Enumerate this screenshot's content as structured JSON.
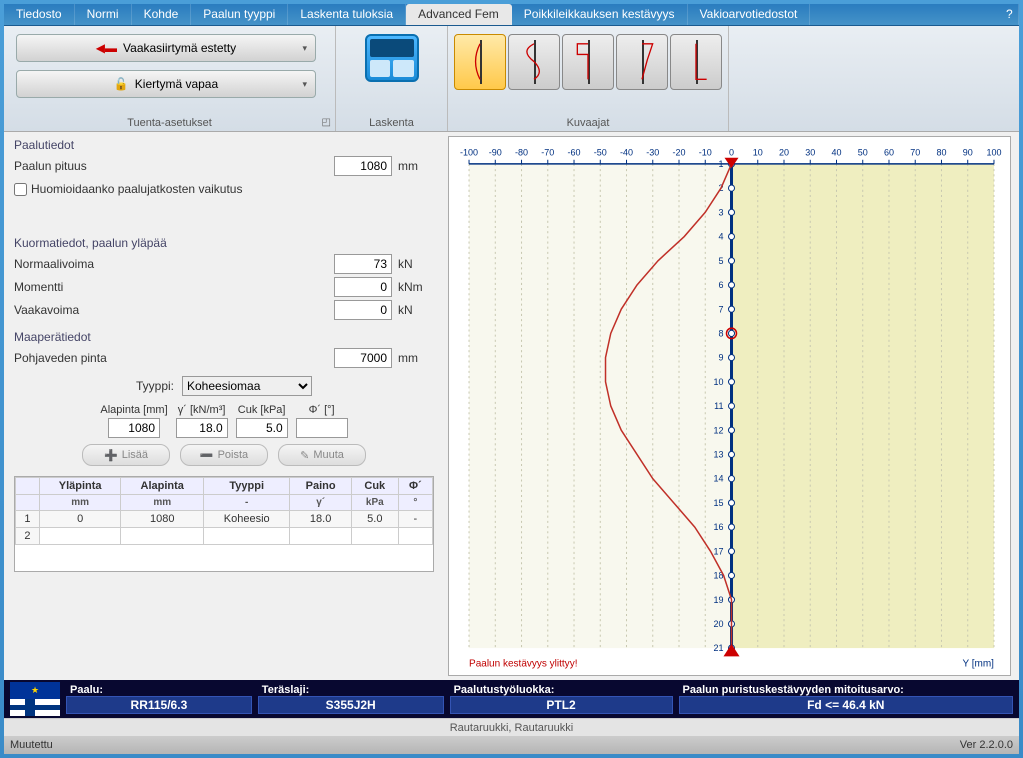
{
  "menu": {
    "items": [
      "Tiedosto",
      "Normi",
      "Kohde",
      "Paalun tyyppi",
      "Laskenta tuloksia",
      "Advanced Fem",
      "Poikkileikkauksen kestävyys",
      "Vakioarvotiedostot"
    ],
    "active_index": 5,
    "help": "?"
  },
  "ribbon": {
    "support": {
      "btn1": "Vaakasiirtymä estetty",
      "btn2": "Kiertymä vapaa",
      "label": "Tuenta-asetukset"
    },
    "calc": {
      "label": "Laskenta"
    },
    "charts": {
      "label": "Kuvaajat"
    }
  },
  "left": {
    "pile": {
      "title": "Paalutiedot",
      "length_label": "Paalun pituus",
      "length_value": "1080",
      "length_unit": "mm",
      "cb_label": "Huomioidaanko paalujatkosten vaikutus"
    },
    "loads": {
      "title": "Kuormatiedot, paalun yläpää",
      "n_label": "Normaalivoima",
      "n_value": "73",
      "n_unit": "kN",
      "m_label": "Momentti",
      "m_value": "0",
      "m_unit": "kNm",
      "v_label": "Vaakavoima",
      "v_value": "0",
      "v_unit": "kN"
    },
    "soil": {
      "title": "Maaperätiedot",
      "gw_label": "Pohjaveden pinta",
      "gw_value": "7000",
      "gw_unit": "mm",
      "type_label": "Tyyppi:",
      "type_value": "Koheesiomaa",
      "cols": {
        "alapinta": "Alapinta [mm]",
        "gamma": "γ´ [kN/m³]",
        "cuk": "Cuk [kPa]",
        "phi": "Φ´ [°]"
      },
      "vals": {
        "alapinta": "1080",
        "gamma": "18.0",
        "cuk": "5.0",
        "phi": ""
      },
      "btns": {
        "add": "Lisää",
        "del": "Poista",
        "edit": "Muuta"
      }
    },
    "grid": {
      "headers": [
        "",
        "Yläpinta",
        "Alapinta",
        "Tyyppi",
        "Paino",
        "Cuk",
        "Φ´"
      ],
      "subheaders": [
        "",
        "mm",
        "mm",
        "-",
        "γ´",
        "kPa",
        "°"
      ],
      "rows": [
        [
          "1",
          "0",
          "1080",
          "Koheesio",
          "18.0",
          "5.0",
          "-"
        ],
        [
          "2",
          "",
          "",
          "",
          "",
          "",
          ""
        ]
      ]
    }
  },
  "chart_data": {
    "type": "line",
    "title": "",
    "xlabel": "",
    "ylabel_right": "Y  [mm]",
    "xlim": [
      -100,
      100
    ],
    "x_ticks": [
      -100,
      -90,
      -80,
      -70,
      -60,
      -50,
      -40,
      -30,
      -20,
      -10,
      0,
      10,
      20,
      30,
      40,
      50,
      60,
      70,
      80,
      90,
      100
    ],
    "y_ticks": [
      1,
      2,
      3,
      4,
      5,
      6,
      7,
      8,
      9,
      10,
      11,
      12,
      13,
      14,
      15,
      16,
      17,
      18,
      19,
      20,
      21
    ],
    "warning": "Paalun kestävyys ylittyy!",
    "series": [
      {
        "name": "pile",
        "color": "#003080",
        "x": [
          0,
          0
        ],
        "y": [
          1,
          21
        ]
      },
      {
        "name": "curve",
        "color": "#c03028",
        "x": [
          0,
          -4,
          -10,
          -18,
          -28,
          -36,
          -42,
          -46,
          -48,
          -48,
          -46,
          -42,
          -36,
          -30,
          -22,
          -14,
          -8,
          -3,
          0,
          0,
          0
        ],
        "y": [
          1,
          2,
          3,
          4,
          5,
          6,
          7,
          8,
          9,
          10,
          11,
          12,
          13,
          14,
          15,
          16,
          17,
          18,
          19,
          20,
          21
        ]
      }
    ],
    "markers": [
      {
        "name": "top-triangle",
        "x": 0,
        "y": 1,
        "shape": "triangle-down",
        "color": "#c00"
      },
      {
        "name": "bottom-triangle",
        "x": 0,
        "y": 21,
        "shape": "triangle-up",
        "color": "#c00"
      },
      {
        "name": "red-ring",
        "x": 0,
        "y": 8,
        "shape": "ring",
        "color": "#c00"
      }
    ]
  },
  "footer": {
    "pile_label": "Paalu:",
    "pile_val": "RR115/6.3",
    "steel_label": "Teräslaji:",
    "steel_val": "S355J2H",
    "class_label": "Paalutustyöluokka:",
    "class_val": "PTL2",
    "cap_label": "Paalun puristuskestävyyden mitoitusarvo:",
    "cap_val": "Fd <= 46.4 kN"
  },
  "company": "Rautaruukki,  Rautaruukki",
  "status": {
    "left": "Muutettu",
    "right": "Ver 2.2.0.0"
  }
}
